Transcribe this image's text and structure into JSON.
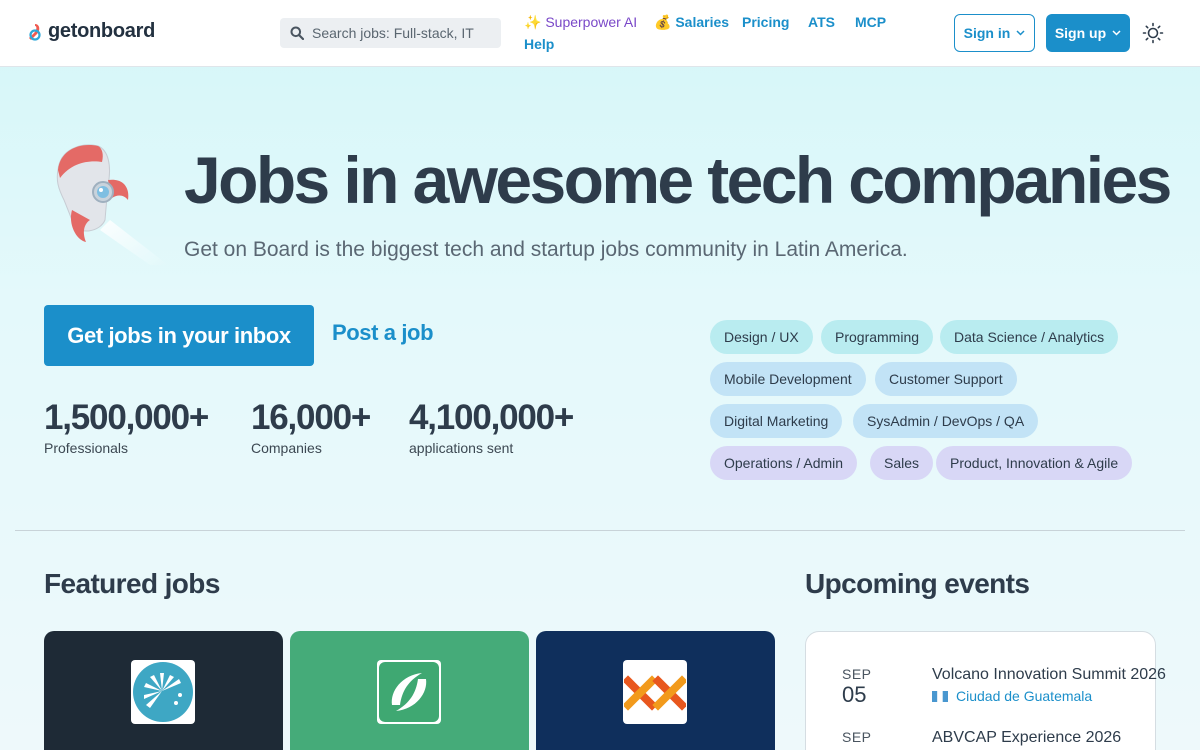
{
  "header": {
    "logo_text": "getonboard",
    "search_placeholder": "Search jobs: Full-stack, IT",
    "nav": {
      "superpower_ai": "✨ Superpower AI",
      "salaries": "💰 Salaries",
      "pricing": "Pricing",
      "ats": "ATS",
      "mcp": "MCP",
      "help": "Help"
    },
    "sign_in": "Sign in",
    "sign_up": "Sign up"
  },
  "hero": {
    "title": "Jobs in awesome tech companies",
    "subtitle": "Get on Board is the biggest tech and startup jobs community in Latin America.",
    "cta_inbox": "Get jobs in your inbox",
    "cta_post": "Post a job"
  },
  "stats": [
    {
      "value": "1,500,000+",
      "label": "Professionals"
    },
    {
      "value": "16,000+",
      "label": "Companies"
    },
    {
      "value": "4,100,000+",
      "label": "applications sent"
    }
  ],
  "categories": [
    "Design / UX",
    "Programming",
    "Data Science / Analytics",
    "Mobile Development",
    "Customer Support",
    "Digital Marketing",
    "SysAdmin / DevOps / QA",
    "Operations / Admin",
    "Sales",
    "Product, Innovation & Agile"
  ],
  "featured": {
    "title": "Featured jobs",
    "cards": [
      {
        "bg": "#1e2a36",
        "logo": "sunburst-logo"
      },
      {
        "bg": "#45ab79",
        "logo": "leaf-logo"
      },
      {
        "bg": "#0f2f5c",
        "logo": "xx-logo"
      }
    ]
  },
  "events": {
    "title": "Upcoming events",
    "items": [
      {
        "month": "SEP",
        "day": "05",
        "title": "Volcano Innovation Summit 2026",
        "location": "Ciudad de Guatemala"
      },
      {
        "month": "SEP",
        "day": "",
        "title": "ABVCAP Experience 2026",
        "location": ""
      }
    ]
  },
  "colors": {
    "accent": "#1b8fca",
    "heading": "#2e3c4b",
    "ai": "#7a48c8"
  }
}
